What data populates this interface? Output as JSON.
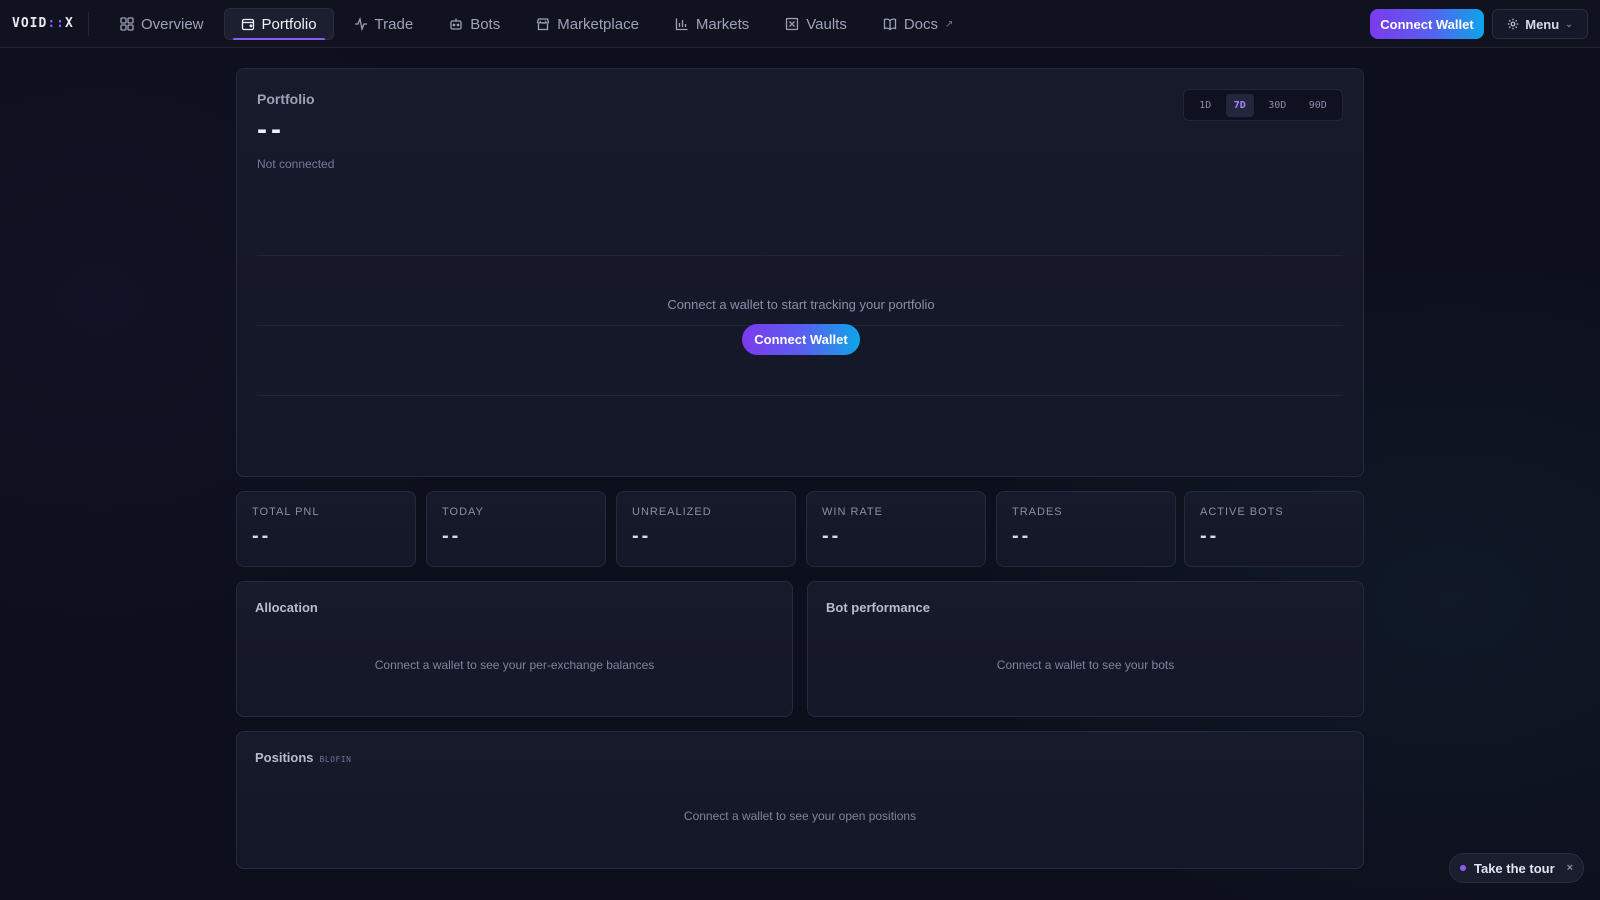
{
  "brand": {
    "logo_left": "VOID",
    "logo_sep": "::",
    "logo_right": "X"
  },
  "nav": {
    "tabs": [
      {
        "label": "Overview",
        "icon": "grid-icon"
      },
      {
        "label": "Portfolio",
        "icon": "wallet-icon",
        "active": true
      },
      {
        "label": "Trade",
        "icon": "activity-icon"
      },
      {
        "label": "Bots",
        "icon": "bot-icon"
      },
      {
        "label": "Marketplace",
        "icon": "store-icon"
      },
      {
        "label": "Markets",
        "icon": "bar-chart-icon"
      },
      {
        "label": "Vaults",
        "icon": "vault-icon"
      },
      {
        "label": "Docs",
        "icon": "book-icon",
        "external": true
      }
    ],
    "connect_label": "Connect Wallet",
    "menu_label": "Menu"
  },
  "portfolio": {
    "title": "Portfolio",
    "value": "--",
    "status": "Not connected",
    "ranges": [
      "1D",
      "7D",
      "30D",
      "90D"
    ],
    "selected_range": "7D",
    "empty_message": "Connect a wallet to start tracking your portfolio",
    "connect_label": "Connect Wallet"
  },
  "stats": [
    {
      "label": "TOTAL PNL",
      "value": "--"
    },
    {
      "label": "TODAY",
      "value": "--"
    },
    {
      "label": "UNREALIZED",
      "value": "--"
    },
    {
      "label": "WIN RATE",
      "value": "--"
    },
    {
      "label": "TRADES",
      "value": "--"
    },
    {
      "label": "ACTIVE BOTS",
      "value": "--"
    }
  ],
  "allocation": {
    "title": "Allocation",
    "message": "Connect a wallet to see your per-exchange balances"
  },
  "bot_performance": {
    "title": "Bot performance",
    "message": "Connect a wallet to see your bots"
  },
  "positions": {
    "title": "Positions",
    "tag": "BLOFIN",
    "message": "Connect a wallet to see your open positions"
  },
  "tour": {
    "label": "Take the tour",
    "close": "×"
  },
  "colors": {
    "accent": "#8b5cf6",
    "gradient_start": "#7c3aed",
    "gradient_end": "#0ea5e9",
    "background": "#0d0f1c"
  }
}
